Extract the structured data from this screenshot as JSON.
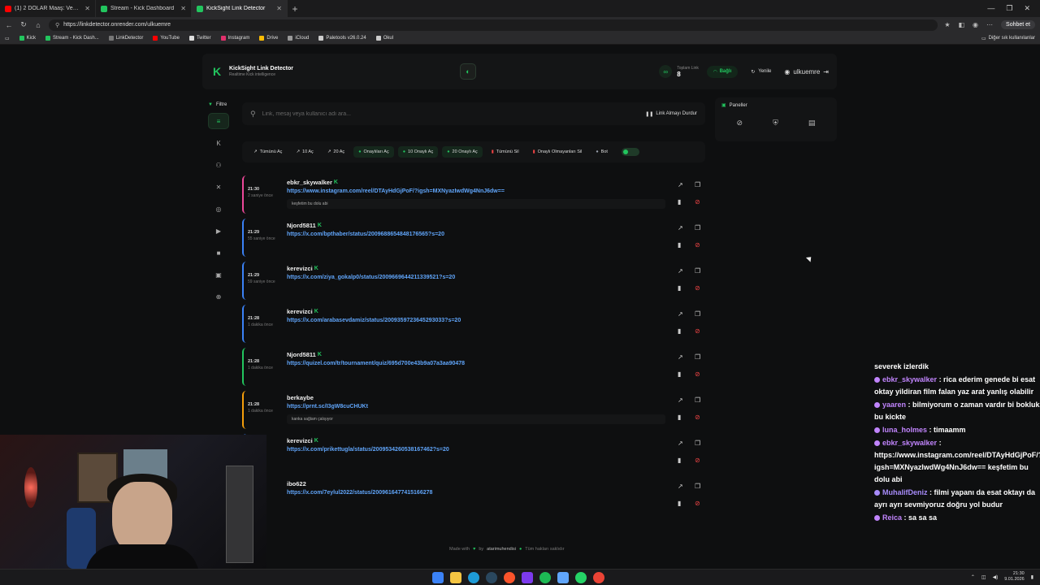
{
  "browser": {
    "tabs": [
      {
        "title": "(1) 2 DOLAR Maaş: Venezuela'da ",
        "color": "#ff0000",
        "active": false
      },
      {
        "title": "Stream - Kick Dashboard",
        "color": "#22c55e",
        "active": false
      },
      {
        "title": "KickSight Link Detector",
        "color": "#22c55e",
        "active": true
      }
    ],
    "url": "https://linkdetector.onrender.com/ulkuemre",
    "chat_button": "Sohbet et",
    "bookmarks": [
      {
        "label": "Kick",
        "color": "#22c55e"
      },
      {
        "label": "Stream - Kick Dash...",
        "color": "#22c55e"
      },
      {
        "label": "LinkDetector",
        "color": "#777777"
      },
      {
        "label": "YouTube",
        "color": "#ff0000"
      },
      {
        "label": "Twitter",
        "color": "#dddddd"
      },
      {
        "label": "Instagram",
        "color": "#e1306c"
      },
      {
        "label": "Drive",
        "color": "#fbbc04"
      },
      {
        "label": "iCloud",
        "color": "#999999"
      },
      {
        "label": "Paletools v26.0.24",
        "color": "#cccccc"
      },
      {
        "label": "Okul",
        "color": "#cccccc"
      }
    ],
    "bookmarks_other": "Diğer sık kullanılanlar"
  },
  "app": {
    "title": "KickSight Link Detector",
    "subtitle": "Realtime Kick intelligence",
    "total_label": "Toplam Link",
    "total_value": "8",
    "connected": "Bağlı",
    "refresh": "Yenile",
    "username": "ulkuemre",
    "filter_label": "Filtre",
    "search_placeholder": "Link, mesaj veya kullanıcı adı ara...",
    "stop_label": "Link Almayı Durdur",
    "panels_label": "Paneller",
    "actions": [
      {
        "label": "Tümünü Aç",
        "style": "plain",
        "icon": "↗"
      },
      {
        "label": "10 Aç",
        "style": "plain",
        "icon": "↗"
      },
      {
        "label": "20 Aç",
        "style": "plain",
        "icon": "↗"
      },
      {
        "label": "Onaylıları Aç",
        "style": "green",
        "icon": "●"
      },
      {
        "label": "10 Onaylı Aç",
        "style": "green",
        "icon": "●"
      },
      {
        "label": "20 Onaylı Aç",
        "style": "green",
        "icon": "●"
      },
      {
        "label": "Tümünü Sil",
        "style": "plain-red",
        "icon": "▮"
      },
      {
        "label": "Onaylı Olmayanları Sil",
        "style": "plain-red",
        "icon": "▮"
      },
      {
        "label": "Bot",
        "style": "plain-gray",
        "icon": "●"
      }
    ],
    "footer": {
      "made": "Made with",
      "by": "by",
      "author": "atarimuhendisi",
      "rights": "Tüm hakları saklıdır"
    }
  },
  "feed": [
    {
      "time": "21:30",
      "ago": "2 saniye önce",
      "user": "ebkr_skywalker",
      "verified": true,
      "link": "https://www.instagram.com/reel/DTAyHdGjPoF/?igsh=MXNyazIwdWg4NnJ6dw==",
      "message": "keşfetim bu dolu abi",
      "accent": "#ec4899"
    },
    {
      "time": "21:29",
      "ago": "55 saniye önce",
      "user": "Njord5811",
      "verified": true,
      "link": "https://x.com/bpthaber/status/2009688654848176565?s=20",
      "message": "",
      "accent": "#3b82f6"
    },
    {
      "time": "21:29",
      "ago": "59 saniye önce",
      "user": "kerevizci",
      "verified": true,
      "link": "https://x.com/ziya_gokalp0/status/2009669644211339521?s=20",
      "message": "",
      "accent": "#3b82f6"
    },
    {
      "time": "21:28",
      "ago": "1 dakika önce",
      "user": "kerevizci",
      "verified": true,
      "link": "https://x.com/arabasevdamiz/status/2009359723645293033?s=20",
      "message": "",
      "accent": "#3b82f6"
    },
    {
      "time": "21:28",
      "ago": "1 dakika önce",
      "user": "Njord5811",
      "verified": true,
      "link": "https://quizel.com/tr/tournament/quiz/695d700e43b9a07a3aa90478",
      "message": "",
      "accent": "#22c55e"
    },
    {
      "time": "21:28",
      "ago": "1 dakika önce",
      "user": "berkaybe",
      "verified": false,
      "link": "https://prnt.sc/I3gW8cuCHUKt",
      "message": "kanka sağlam çalışıyor",
      "accent": "#f59e0b"
    },
    {
      "time": "",
      "ago": "önce",
      "user": "kerevizci",
      "verified": true,
      "link": "https://x.com/prikettugla/status/2009534260538167462?s=20",
      "message": "",
      "accent": "#3b82f6"
    },
    {
      "time": "",
      "ago": "önce",
      "user": "ibo622",
      "verified": false,
      "link": "https://x.com/7eylul2022/status/2009616477415166278",
      "message": "",
      "accent": "#3b82f6"
    }
  ],
  "chat": [
    {
      "name": "",
      "text": "severek izlerdik",
      "color": "#ffffff"
    },
    {
      "name": "ebkr_skywalker",
      "text": " : rica ederim genede bi esat oktay yildiran film falan yaz arat yanlış olabilir",
      "color": "#c084fc"
    },
    {
      "name": "yaaren",
      "text": " : bilmiyorum o zaman vardır bi bokluk bu kickte",
      "color": "#c084fc"
    },
    {
      "name": "luna_holmes",
      "text": " : timaamm",
      "color": "#c084fc"
    },
    {
      "name": "ebkr_skywalker",
      "text": " : https://www.instagram.com/reel/DTAyHdGjPoF/?igsh=MXNyazIwdWg4NnJ6dw== keşfetim bu dolu abi",
      "color": "#c084fc"
    },
    {
      "name": "MuhalifDeniz",
      "text": " : filmi yapanı da esat oktayı da ayrı ayrı sevmiyoruz doğru yol budur",
      "color": "#a78bfa"
    },
    {
      "name": "Reica",
      "text": " : sa sa sa",
      "color": "#c084fc"
    }
  ],
  "taskbar": {
    "time": "21:30",
    "date": "9.01.2026"
  }
}
